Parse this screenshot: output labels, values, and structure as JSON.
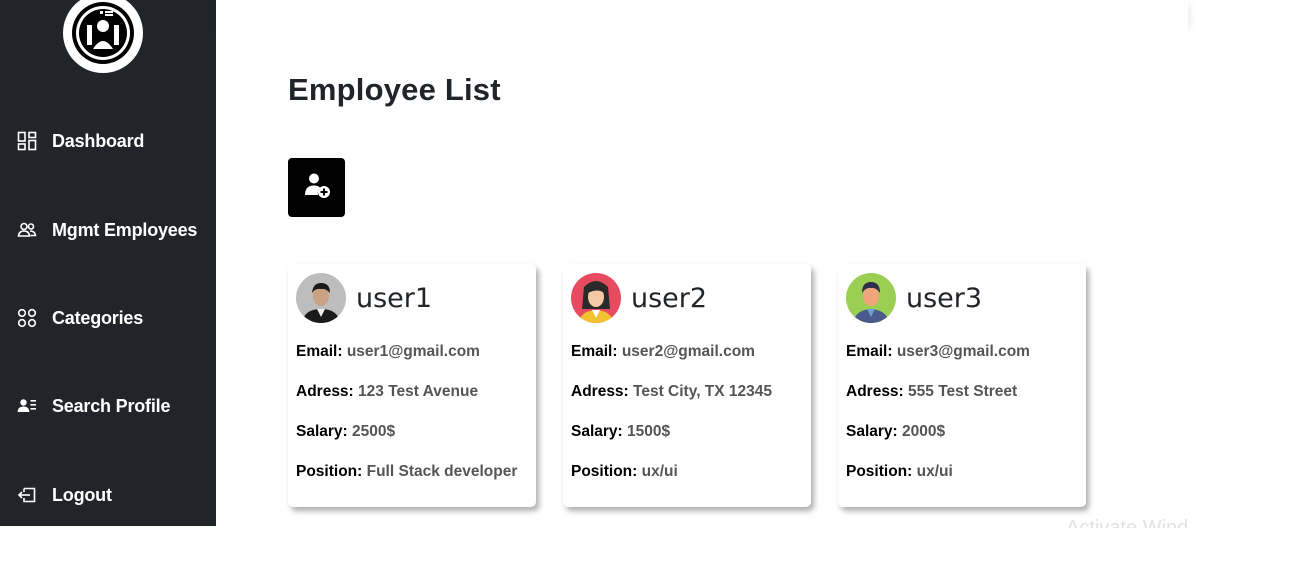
{
  "sidebar": {
    "logo_icon": "employees-logo-icon",
    "items": [
      {
        "label": "Dashboard",
        "icon": "grid-icon"
      },
      {
        "label": "Mgmt Employees",
        "icon": "people-icon"
      },
      {
        "label": "Categories",
        "icon": "circles-icon"
      },
      {
        "label": "Search Profile",
        "icon": "person-lines-icon"
      },
      {
        "label": "Logout",
        "icon": "logout-icon"
      }
    ]
  },
  "main": {
    "title": "Employee List",
    "add_button_icon": "person-plus-icon"
  },
  "employees": [
    {
      "name": "user1",
      "email_label": "Email:",
      "email": "user1@gmail.com",
      "address_label": "Adress:",
      "address": "123 Test Avenue",
      "salary_label": "Salary:",
      "salary": "2500$",
      "position_label": "Position:",
      "position": "Full Stack developer"
    },
    {
      "name": "user2",
      "email_label": "Email:",
      "email": "user2@gmail.com",
      "address_label": "Adress:",
      "address": "Test City, TX 12345",
      "salary_label": "Salary:",
      "salary": "1500$",
      "position_label": "Position:",
      "position": "ux/ui"
    },
    {
      "name": "user3",
      "email_label": "Email:",
      "email": "user3@gmail.com",
      "address_label": "Adress:",
      "address": "555 Test Street",
      "salary_label": "Salary:",
      "salary": "2000$",
      "position_label": "Position:",
      "position": "ux/ui"
    }
  ],
  "colors": {
    "sidebar_bg": "#212529",
    "button_bg": "#000000",
    "text": "#212529",
    "value_text": "#555555"
  },
  "watermark": "Activate Windows"
}
